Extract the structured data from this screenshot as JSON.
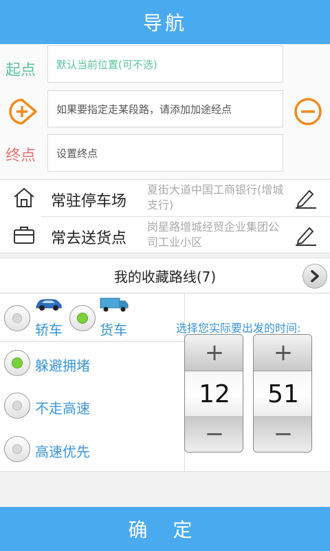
{
  "title": "导航",
  "route": {
    "start_label": "起点",
    "start_placeholder": "默认当前位置(可不选)",
    "via_placeholder": "如果要指定走某段路，请添加加途经点",
    "end_label": "终点",
    "end_placeholder": "设置终点"
  },
  "places": [
    {
      "name": "常驻停车场",
      "address": "夏街大道中国工商银行(增城支行)"
    },
    {
      "name": "常去送货点",
      "address": "岗星路增城经贸企业集团公司工业小区"
    }
  ],
  "favorites": {
    "label": "我的收藏路线(7)"
  },
  "vehicle": {
    "car_label": "轿车",
    "truck_label": "货车",
    "selected": "truck"
  },
  "preferences": [
    {
      "label": "躲避拥堵",
      "selected": true
    },
    {
      "label": "不走高速",
      "selected": false
    },
    {
      "label": "高速优先",
      "selected": false
    }
  ],
  "time": {
    "hint": "选择您实际要出发的时间:",
    "hour": "12",
    "minute": "51",
    "plus": "+",
    "minus": "−"
  },
  "confirm_label": "确 定",
  "colors": {
    "header": "#4aaaf0",
    "start_label": "#5bc49a",
    "end_label": "#e8736f",
    "accent_orange": "#f28a1d",
    "option_text": "#3a95d8"
  }
}
